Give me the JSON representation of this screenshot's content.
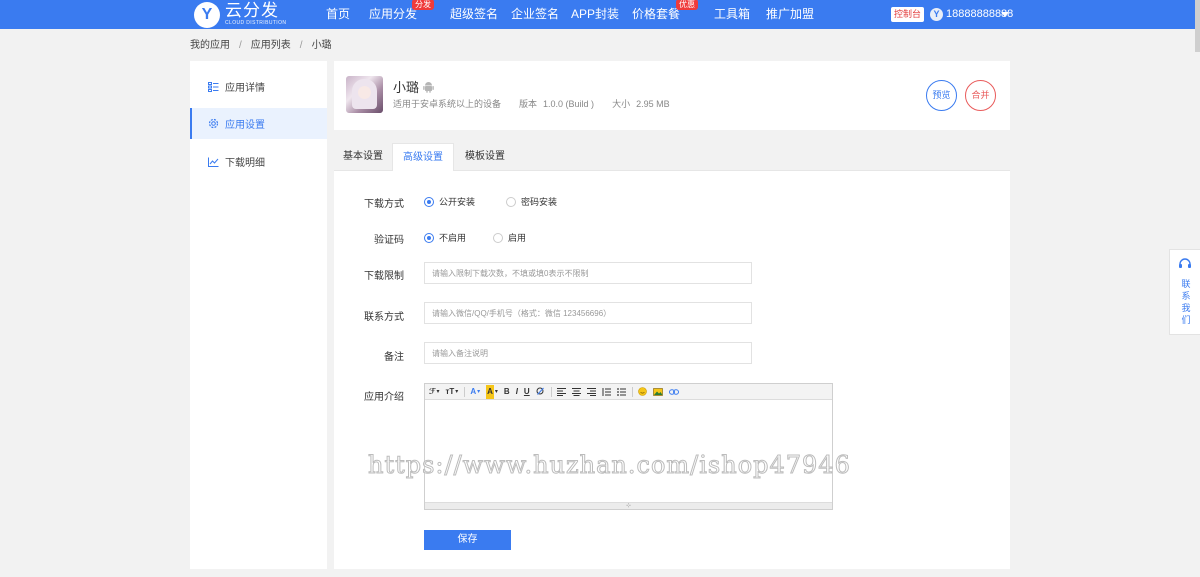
{
  "brand": {
    "title": "云分发",
    "subtitle": "CLOUD DISTRIBUTION",
    "mark": "Y",
    "color": "#3a7bf0"
  },
  "nav": {
    "items": [
      {
        "label": "首页"
      },
      {
        "label": "应用分发",
        "badge": "分发"
      },
      {
        "label": "超级签名"
      },
      {
        "label": "企业签名"
      },
      {
        "label": "APP封装"
      },
      {
        "label": "价格套餐",
        "badge": "优惠"
      },
      {
        "label": "工具箱"
      },
      {
        "label": "推广加盟"
      }
    ],
    "console_label": "控制台",
    "user_avatar": "Y",
    "username": "18888888888"
  },
  "breadcrumb": [
    "我的应用",
    "应用列表",
    "小璐"
  ],
  "sidebar": {
    "items": [
      {
        "label": "应用详情",
        "icon": "list-icon"
      },
      {
        "label": "应用设置",
        "icon": "gear-icon",
        "active": true
      },
      {
        "label": "下载明细",
        "icon": "line-chart-icon"
      }
    ]
  },
  "app": {
    "name": "小璐",
    "platform_icon": "android-icon",
    "compatibility": "适用于安卓系统以上的设备",
    "version_label": "版本",
    "version": "1.0.0 (Build )",
    "size_label": "大小",
    "size": "2.95 MB",
    "preview_label": "预览",
    "merge_label": "合并"
  },
  "tabs": [
    {
      "label": "基本设置"
    },
    {
      "label": "高级设置",
      "active": true
    },
    {
      "label": "模板设置"
    }
  ],
  "form": {
    "download_mode": {
      "label": "下载方式",
      "options": [
        "公开安装",
        "密码安装"
      ],
      "selected": "公开安装"
    },
    "captcha": {
      "label": "验证码",
      "options": [
        "不启用",
        "启用"
      ],
      "selected": "不启用"
    },
    "download_limit": {
      "label": "下载限制",
      "value": "",
      "placeholder": "请输入限制下载次数，不填或填0表示不限制"
    },
    "contact": {
      "label": "联系方式",
      "value": "",
      "placeholder": "请输入微信/QQ/手机号（格式：微信 123456696）"
    },
    "remark": {
      "label": "备注",
      "value": "",
      "placeholder": "请输入备注说明"
    },
    "intro": {
      "label": "应用介绍",
      "content": ""
    },
    "save_label": "保存"
  },
  "editor_toolbar": {
    "font_family": "ℱ",
    "font_size": "тT",
    "text_color": "A",
    "highlight": "A",
    "bold": "B",
    "italic": "I",
    "underline": "U"
  },
  "watermark": "https://www.huzhan.com/ishop47946",
  "contact_float": {
    "label": "联系我们"
  }
}
